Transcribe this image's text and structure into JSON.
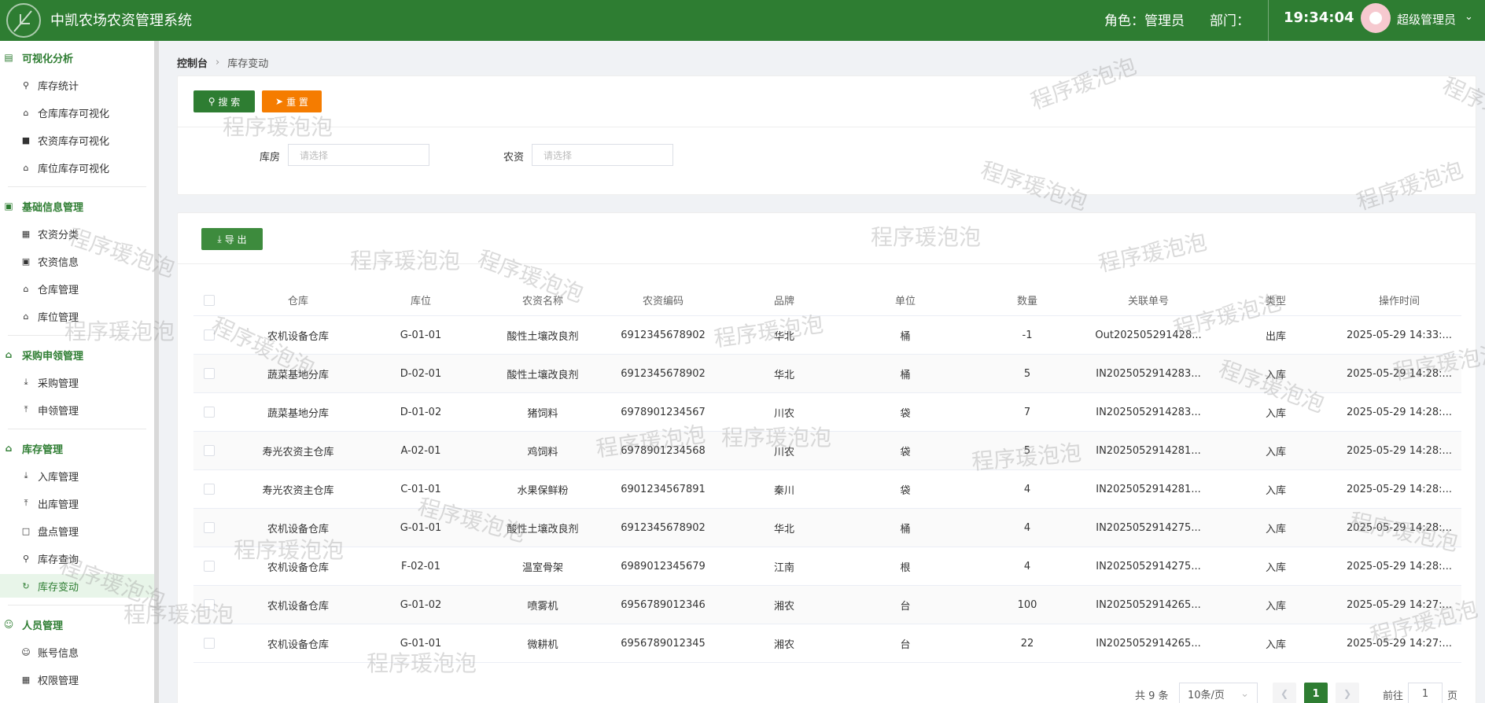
{
  "app": {
    "title": "中凯农场农资管理系统",
    "role_text": "角色：管理员",
    "dept_text": "部门：",
    "time": "19:34:04",
    "user_name": "超级管理员",
    "brand_color": "#2e7d32"
  },
  "sidebar": {
    "groups": [
      {
        "label": "可视化分析",
        "icon": "chart-icon",
        "items": [
          {
            "label": "库存统计",
            "icon": "search-icon"
          },
          {
            "label": "仓库库存可视化",
            "icon": "home-icon"
          },
          {
            "label": "农资库存可视化",
            "icon": "lock-icon"
          },
          {
            "label": "库位库存可视化",
            "icon": "home-icon"
          }
        ]
      },
      {
        "label": "基础信息管理",
        "icon": "bag-icon",
        "items": [
          {
            "label": "农资分类",
            "icon": "grid-icon"
          },
          {
            "label": "农资信息",
            "icon": "bag-icon"
          },
          {
            "label": "仓库管理",
            "icon": "house-outline-icon"
          },
          {
            "label": "库位管理",
            "icon": "house-outline-icon"
          }
        ]
      },
      {
        "label": "采购申领管理",
        "icon": "home-icon",
        "items": [
          {
            "label": "采购管理",
            "icon": "download-icon"
          },
          {
            "label": "申领管理",
            "icon": "upload-icon"
          }
        ]
      },
      {
        "label": "库存管理",
        "icon": "home-icon",
        "items": [
          {
            "label": "入库管理",
            "icon": "download-icon"
          },
          {
            "label": "出库管理",
            "icon": "upload-icon"
          },
          {
            "label": "盘点管理",
            "icon": "document-icon"
          },
          {
            "label": "库存查询",
            "icon": "search-icon"
          },
          {
            "label": "库存变动",
            "icon": "refresh-icon",
            "active": true
          }
        ]
      },
      {
        "label": "人员管理",
        "icon": "user-icon",
        "items": [
          {
            "label": "账号信息",
            "icon": "user-icon"
          },
          {
            "label": "权限管理",
            "icon": "grid-icon"
          }
        ]
      }
    ]
  },
  "breadcrumb": {
    "root": "控制台",
    "current": "库存变动"
  },
  "search": {
    "search_label": "搜 索",
    "reset_label": "重 置",
    "warehouse_label": "库房",
    "warehouse_placeholder": "请选择",
    "material_label": "农资",
    "material_placeholder": "请选择"
  },
  "toolbar": {
    "export_label": "导 出"
  },
  "table": {
    "columns": [
      "仓库",
      "库位",
      "农资名称",
      "农资编码",
      "品牌",
      "单位",
      "数量",
      "关联单号",
      "类型",
      "操作时间"
    ],
    "rows": [
      [
        "农机设备仓库",
        "G-01-01",
        "酸性土壤改良剂",
        "6912345678902",
        "华北",
        "桶",
        "-1",
        "Out202505291428...",
        "出库",
        "2025-05-29 14:33:..."
      ],
      [
        "蔬菜基地分库",
        "D-02-01",
        "酸性土壤改良剂",
        "6912345678902",
        "华北",
        "桶",
        "5",
        "IN2025052914283...",
        "入库",
        "2025-05-29 14:28:..."
      ],
      [
        "蔬菜基地分库",
        "D-01-02",
        "猪饲料",
        "6978901234567",
        "川农",
        "袋",
        "7",
        "IN2025052914283...",
        "入库",
        "2025-05-29 14:28:..."
      ],
      [
        "寿光农资主仓库",
        "A-02-01",
        "鸡饲料",
        "6978901234568",
        "川农",
        "袋",
        "5",
        "IN2025052914281...",
        "入库",
        "2025-05-29 14:28:..."
      ],
      [
        "寿光农资主仓库",
        "C-01-01",
        "水果保鲜粉",
        "6901234567891",
        "秦川",
        "袋",
        "4",
        "IN2025052914281...",
        "入库",
        "2025-05-29 14:28:..."
      ],
      [
        "农机设备仓库",
        "G-01-01",
        "酸性土壤改良剂",
        "6912345678902",
        "华北",
        "桶",
        "4",
        "IN2025052914275...",
        "入库",
        "2025-05-29 14:28:..."
      ],
      [
        "农机设备仓库",
        "F-02-01",
        "温室骨架",
        "6989012345679",
        "江南",
        "根",
        "4",
        "IN2025052914275...",
        "入库",
        "2025-05-29 14:28:..."
      ],
      [
        "农机设备仓库",
        "G-01-02",
        "喷雾机",
        "6956789012346",
        "湘农",
        "台",
        "100",
        "IN2025052914265...",
        "入库",
        "2025-05-29 14:27:..."
      ],
      [
        "农机设备仓库",
        "G-01-01",
        "微耕机",
        "6956789012345",
        "湘农",
        "台",
        "22",
        "IN2025052914265...",
        "入库",
        "2025-05-29 14:27:..."
      ]
    ]
  },
  "pagination": {
    "total_text": "共 9 条",
    "page_size": "10条/页",
    "current_page": "1",
    "goto_label": "前往",
    "goto_value": "1",
    "page_suffix": "页"
  },
  "watermark": {
    "text": "程序瑗泡泡"
  }
}
